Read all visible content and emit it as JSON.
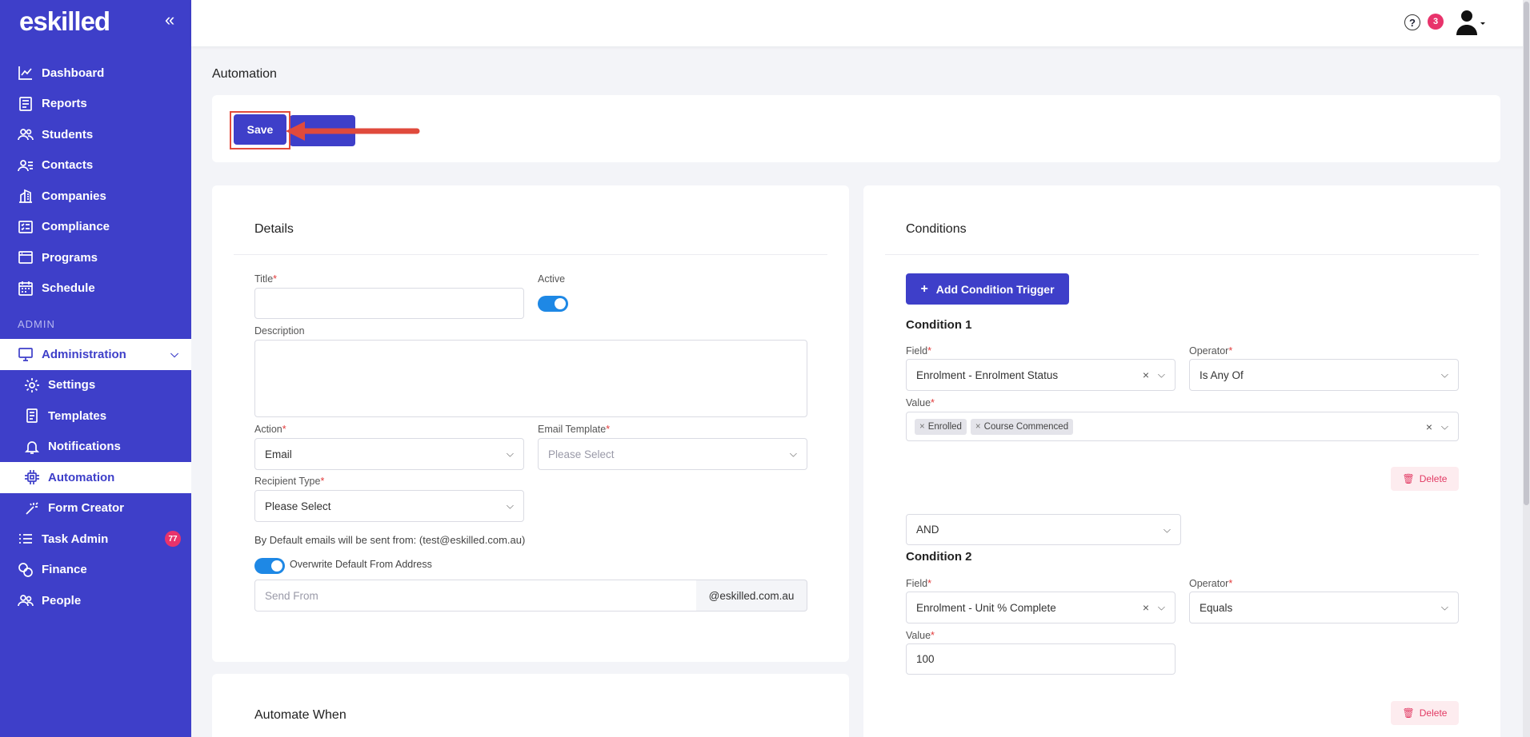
{
  "brand": {
    "logo": "eskilled",
    "collapse": "«"
  },
  "sidebar": {
    "items": [
      {
        "label": "Dashboard"
      },
      {
        "label": "Reports"
      },
      {
        "label": "Students"
      },
      {
        "label": "Contacts"
      },
      {
        "label": "Companies"
      },
      {
        "label": "Compliance"
      },
      {
        "label": "Programs"
      },
      {
        "label": "Schedule"
      }
    ],
    "section": "ADMIN",
    "admin": {
      "label": "Administration",
      "chevron": "⌵"
    },
    "admin_sub": [
      {
        "label": "Settings"
      },
      {
        "label": "Templates"
      },
      {
        "label": "Notifications"
      },
      {
        "label": "Automation"
      },
      {
        "label": "Form Creator"
      }
    ],
    "task_admin": {
      "label": "Task Admin",
      "badge": "77"
    },
    "finance": {
      "label": "Finance"
    },
    "people": {
      "label": "People"
    }
  },
  "topbar": {
    "help": "?",
    "notifications": "3"
  },
  "page": {
    "title": "Automation"
  },
  "toolbar": {
    "save_label": "Save"
  },
  "details": {
    "title": "Details",
    "title_label": "Title",
    "title_value": "",
    "active_label": "Active",
    "description_label": "Description",
    "action_label": "Action",
    "action_value": "Email",
    "email_template_label": "Email Template",
    "email_template_placeholder": "Please Select",
    "recipient_label": "Recipient Type",
    "recipient_value": "Please Select",
    "default_from_note": "By Default emails will be sent from: (test@eskilled.com.au)",
    "overwrite_label": "Overwrite Default From Address",
    "send_from_placeholder": "Send From",
    "domain_suffix": "@eskilled.com.au"
  },
  "automate_when": {
    "title": "Automate When"
  },
  "conditions": {
    "title": "Conditions",
    "add_trigger": "Add Condition Trigger",
    "field_label": "Field",
    "operator_label": "Operator",
    "value_label": "Value",
    "delete_label": "Delete",
    "list": [
      {
        "title": "Condition 1",
        "field": "Enrolment - Enrolment Status",
        "operator": "Is Any Of",
        "chips": [
          "Enrolled",
          "Course Commenced"
        ]
      },
      {
        "title": "Condition 2",
        "field": "Enrolment - Unit % Complete",
        "operator": "Equals",
        "value": "100"
      }
    ],
    "joiner": "AND"
  }
}
